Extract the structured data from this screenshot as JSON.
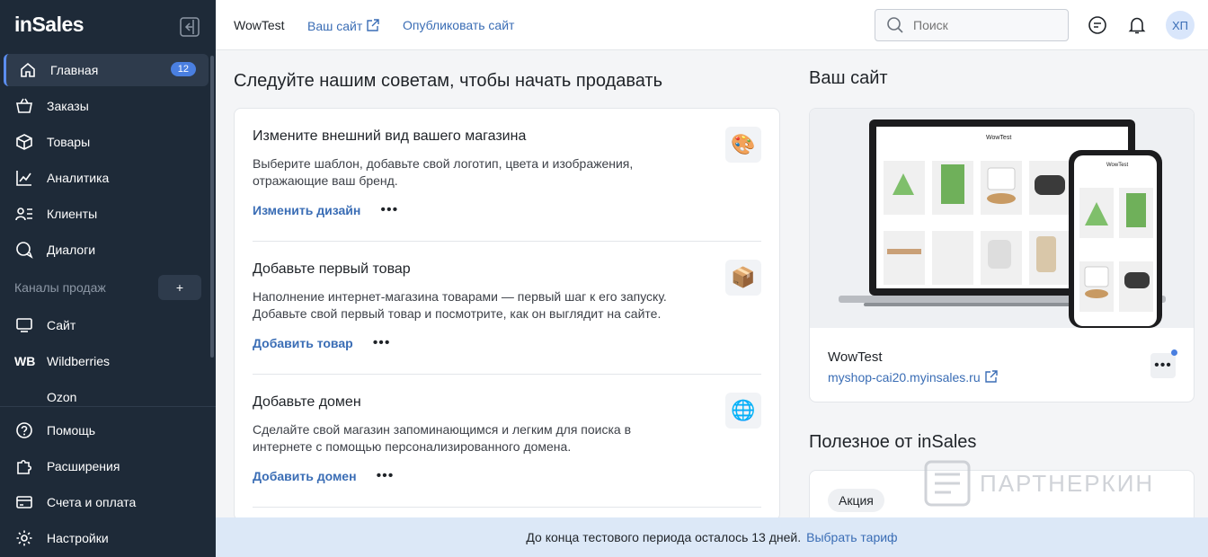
{
  "brand": {
    "logo": "inSales"
  },
  "sidebar": {
    "items": [
      {
        "label": "Главная",
        "icon": "home-icon",
        "badge": "12"
      },
      {
        "label": "Заказы",
        "icon": "basket-icon"
      },
      {
        "label": "Товары",
        "icon": "box-icon"
      },
      {
        "label": "Аналитика",
        "icon": "chart-icon"
      },
      {
        "label": "Клиенты",
        "icon": "clients-icon"
      },
      {
        "label": "Диалоги",
        "icon": "dialog-icon"
      }
    ],
    "channels_title": "Каналы продаж",
    "channels_add": "+",
    "channels": [
      {
        "label": "Сайт",
        "icon": "monitor-icon"
      },
      {
        "label": "Wildberries",
        "icon_text": "WB"
      },
      {
        "label": "Ozon"
      }
    ],
    "bottom": [
      {
        "label": "Помощь",
        "icon": "help-icon"
      },
      {
        "label": "Расширения",
        "icon": "puzzle-icon"
      },
      {
        "label": "Счета и оплата",
        "icon": "card-icon"
      },
      {
        "label": "Настройки",
        "icon": "gear-icon"
      }
    ]
  },
  "topbar": {
    "shop_name": "WowTest",
    "site_link": "Ваш сайт",
    "publish_link": "Опубликовать сайт",
    "search_placeholder": "Поиск",
    "avatar": "ХП"
  },
  "main": {
    "title": "Следуйте нашим советам, чтобы начать продавать",
    "tips": [
      {
        "title": "Измените внешний вид вашего магазина",
        "text": "Выберите шаблон, добавьте свой логотип, цвета и изображения, отражающие ваш бренд.",
        "action": "Изменить дизайн",
        "more": "•••",
        "icon": "palette-icon"
      },
      {
        "title": "Добавьте первый товар",
        "text": "Наполнение интернет-магазина товарами — первый шаг к его запуску. Добавьте свой первый товар и посмотрите, как он выглядит на сайте.",
        "action": "Добавить товар",
        "more": "•••",
        "icon": "package-icon"
      },
      {
        "title": "Добавьте домен",
        "text": "Сделайте свой магазин запоминающимся и легким для поиска в интернете с помощью персонализированного домена.",
        "action": "Добавить домен",
        "more": "•••",
        "icon": "globe-icon"
      }
    ]
  },
  "site": {
    "title": "Ваш сайт",
    "name": "WowTest",
    "url": "myshop-cai20.myinsales.ru",
    "more": "•••",
    "preview_shop": "WowTest"
  },
  "useful": {
    "title": "Полезное от inSales",
    "tag": "Акция"
  },
  "watermark": "ПАРТНЕРКИН",
  "banner": {
    "text": "До конца тестового периода осталось 13 дней.",
    "link": "Выбрать тариф"
  },
  "colors": {
    "sidebar": "#1e2a38",
    "accent": "#3a6db5",
    "badge": "#4a7fe0",
    "banner": "#dce8f7"
  }
}
